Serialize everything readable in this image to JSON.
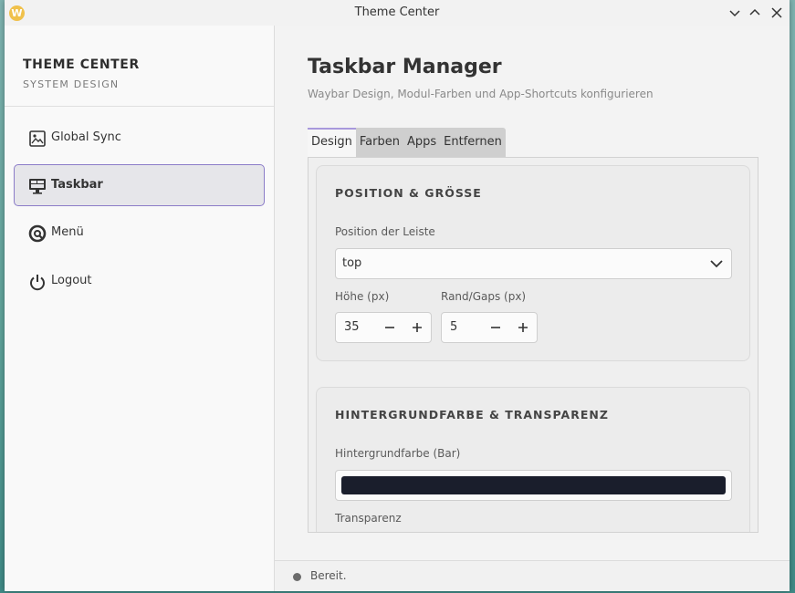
{
  "window": {
    "title": "Theme Center",
    "logo_letter": "W"
  },
  "sidebar": {
    "brand_title": "THEME CENTER",
    "brand_subtitle": "SYSTEM DESIGN",
    "items": [
      {
        "label": "Global Sync",
        "icon": "image-sync-icon",
        "active": false
      },
      {
        "label": "Taskbar",
        "icon": "monitor-icon",
        "active": true
      },
      {
        "label": "Menü",
        "icon": "search-ring-icon",
        "active": false
      },
      {
        "label": "Logout",
        "icon": "power-icon",
        "active": false
      }
    ]
  },
  "main": {
    "title": "Taskbar Manager",
    "subtitle": "Waybar Design, Modul-Farben und App-Shortcuts konfigurieren",
    "tabs": [
      "Design",
      "Farben",
      "Apps",
      "Entfernen"
    ],
    "active_tab": "Design",
    "position_card": {
      "title": "POSITION & GRÖSSE",
      "position_label": "Position der Leiste",
      "position_value": "top",
      "height_label": "Höhe (px)",
      "height_value": "35",
      "gaps_label": "Rand/Gaps (px)",
      "gaps_value": "5"
    },
    "background_card": {
      "title": "HINTERGRUNDFARBE & TRANSPARENZ",
      "bg_label": "Hintergrundfarbe (Bar)",
      "bg_color": "#1a1e2c",
      "transparency_label": "Transparenz"
    }
  },
  "status": {
    "text": "Bereit."
  },
  "colors": {
    "accent": "#8b7cc8"
  }
}
